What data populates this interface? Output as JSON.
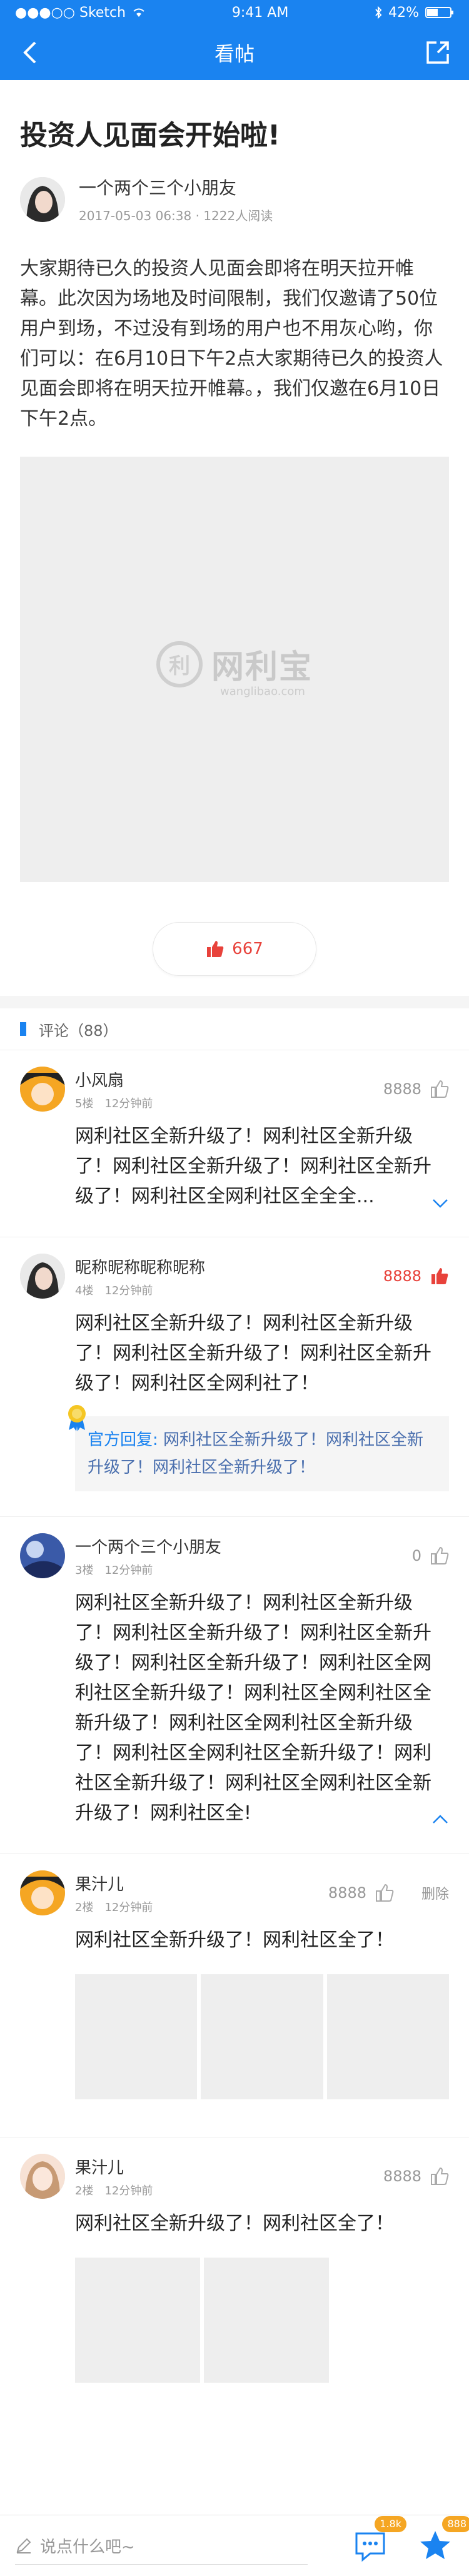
{
  "statusbar": {
    "carrier": "●●●○○ Sketch",
    "time": "9:41 AM",
    "battery": "42%"
  },
  "navbar": {
    "title": "看帖"
  },
  "post": {
    "title": "投资人见面会开始啦!",
    "author": "一个两个三个小朋友",
    "date": "2017-05-03 06:38",
    "views": "1222人阅读",
    "body": "大家期待已久的投资人见面会即将在明天拉开帷幕。此次因为场地及时间限制，我们仅邀请了50位用户到场，不过没有到场的用户也不用灰心哟，你们可以：在6月10日下午2点大家期待已久的投资人见面会即将在明天拉开帷幕。，我们仅邀在6月10日下午2点。",
    "logo_mark": "利",
    "logo_text": "网利宝",
    "logo_sub": "wanglibao.com",
    "likes": "667"
  },
  "comments_header": "评论（88）",
  "comments": [
    {
      "name": "小风扇",
      "floor": "5楼",
      "time": "12分钟前",
      "likes": "8888",
      "text": "网利社区全新升级了！网利社区全新升级了！网利社区全新升级了！网利社区全新升级了！网利社区全网利社区全全全..."
    },
    {
      "name": "昵称昵称昵称昵称",
      "floor": "4楼",
      "time": "12分钟前",
      "likes": "8888",
      "text": "网利社区全新升级了！网利社区全新升级了！网利社区全新升级了！网利社区全新升级了！网利社区全网利社了！",
      "reply_label": "官方回复:",
      "reply_text": "网利社区全新升级了！网利社区全新升级了！网利社区全新升级了！"
    },
    {
      "name": "一个两个三个小朋友",
      "floor": "3楼",
      "time": "12分钟前",
      "likes": "0",
      "text": "网利社区全新升级了！网利社区全新升级了！网利社区全新升级了！网利社区全新升级了！网利社区全新升级了！网利社区全网利社区全新升级了！网利社区全网利社区全新升级了！网利社区全网利社区全新升级了！网利社区全网利社区全新升级了！网利社区全新升级了！网利社区全网利社区全新升级了！网利社区全!"
    },
    {
      "name": "果汁儿",
      "floor": "2楼",
      "time": "12分钟前",
      "likes": "8888",
      "delete": "删除",
      "text": "网利社区全新升级了！网利社区全了！"
    },
    {
      "name": "果汁儿",
      "floor": "2楼",
      "time": "12分钟前",
      "likes": "8888",
      "text": "网利社区全新升级了！网利社区全了！"
    }
  ],
  "bottombar": {
    "placeholder": "说点什么吧~",
    "comments_badge": "1.8k",
    "fav_badge": "888"
  },
  "colors": {
    "brand": "#1a83f0",
    "like": "#e8423b",
    "badge": "#f5a623"
  }
}
